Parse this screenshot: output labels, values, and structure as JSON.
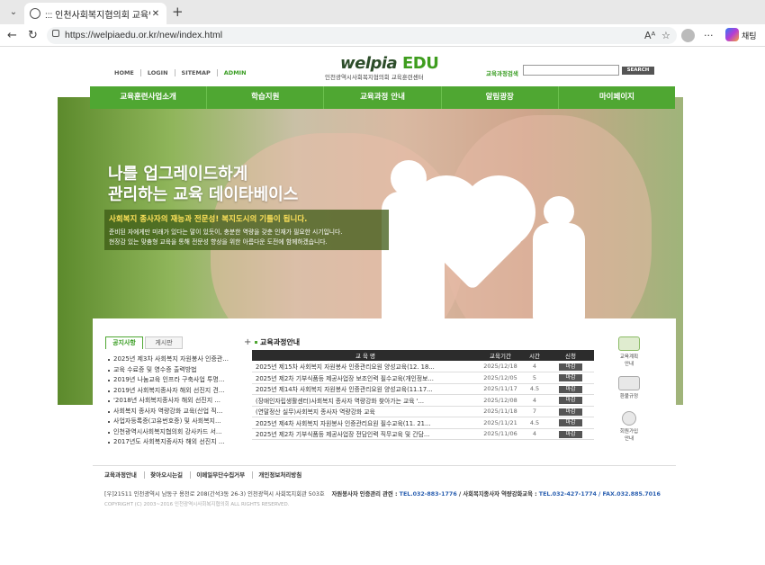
{
  "browser": {
    "tab_title": "::: 인천사회복지협의회 교육인적",
    "url": "https://welpiaedu.or.kr/new/index.html",
    "copilot_label": "채팅"
  },
  "header": {
    "top_links": [
      "HOME",
      "LOGIN",
      "SITEMAP",
      "ADMIN"
    ],
    "logo_main": "welpia ",
    "logo_edu": "EDU",
    "logo_sub": "인천광역시사회복지협의회 교육훈련센터",
    "search_label": "교육과정검색",
    "search_button": "SEARCH"
  },
  "gnb": [
    "교육훈련사업소개",
    "학습지원",
    "교육과정 안내",
    "알림광장",
    "마이페이지"
  ],
  "hero": {
    "headline_1": "나를 업그레이드하게",
    "headline_2": "관리하는 교육 데이타베이스",
    "sub_1": "사회복지 종사자의 재능과 전문성! 복지도시의 기틀이 됩니다.",
    "sub_2": "준비된 자에게만 미래가 있다는 말이 있듯이, 충분한 역량을 갖춘 인재가 필요한 시기입니다.",
    "sub_3": "현장감 있는 맞춤형 교육을 통해 전문성 향상을 위한 아름다운 도전에 함께하겠습니다."
  },
  "notice": {
    "tab_on": "공지사항",
    "tab_off": "게시판",
    "plus": "+",
    "items": [
      "2025년 제3차 사회복지 자원봉사 인증관...",
      "교육 수료증 및 영수증 출력방법",
      "2019년 나눔교육 인프라 구축사업 투명...",
      "2019년 사회복지종사자 해외 선진지 견...",
      "'2018년 사회복지종사자 해외 선진지 ...",
      "사회복지 종사자 역량강화 교육(산업 직...",
      "사업자등록증(고유번호증) 및 사회복지...",
      "인천광역시사회복지협의회 강사카드 서...",
      "2017년도 사회복지종사자 해외 선진지 ..."
    ]
  },
  "courses": {
    "title": "교육과정안내",
    "headers": [
      "교 육 명",
      "교육기간",
      "시간",
      "신청"
    ],
    "rows": [
      {
        "name": "2025년 제15차 사회복지 자원봉사 인증관리요원 양성교육(12. 18...",
        "date": "2025/12/18",
        "hours": "4",
        "status": "마감"
      },
      {
        "name": "2025년 제2차 기부식품등 제공사업장 보조인력 필수교육(개인정보...",
        "date": "2025/12/05",
        "hours": "5",
        "status": "마감"
      },
      {
        "name": "2025년 제14차 사회복지 자원봉사 인증관리요원 양성교육(11.17...",
        "date": "2025/11/17",
        "hours": "4.5",
        "status": "마감"
      },
      {
        "name": "(장애인자립생활센터)사회복지 종사자 역량강화 찾아가는 교육 '...",
        "date": "2025/12/08",
        "hours": "4",
        "status": "마감"
      },
      {
        "name": "(연말정산 실무)사회복지 종사자 역량강화 교육",
        "date": "2025/11/18",
        "hours": "7",
        "status": "마감"
      },
      {
        "name": "2025년 제4차 사회복지 자원봉사 인증관리요원 필수교육(11. 21...",
        "date": "2025/11/21",
        "hours": "4.5",
        "status": "마감"
      },
      {
        "name": "2025년 제2차 기부식품등 제공사업장 전담인력 직무교육 및 간담...",
        "date": "2025/11/06",
        "hours": "4",
        "status": "마감"
      }
    ]
  },
  "quick": [
    {
      "label_1": "교육계획",
      "label_2": "안내",
      "icon": "calendar-icon"
    },
    {
      "label_1": "환불규정",
      "label_2": "",
      "icon": "refund-icon"
    },
    {
      "label_1": "회원가입",
      "label_2": "안내",
      "icon": "member-icon"
    }
  ],
  "footer": {
    "links": [
      "교육과정안내",
      "찾아오시는길",
      "이메일무단수집거부",
      "개인정보처리방침"
    ],
    "address": "[우]21511 인천광역시 남동구 용천로 208(간석3동 26-3) 인천광역시 사회복지회관 503호",
    "contact_1_label": "자원봉사자 인증관리 관련 : ",
    "contact_1_tel": "TEL.032-883-1776",
    "contact_2_label": " / 사회복지종사자 역량강화교육 : ",
    "contact_2_tel": "TEL.032-427-1774 / FAX.032.885.7016",
    "copyright": "COPYRIGHT (C) 2003~2016 인천광역시사회복지협의회 ALL RIGHTS RESERVED."
  },
  "colors": {
    "accent": "#4fa732",
    "dark": "#2c2c2c"
  }
}
